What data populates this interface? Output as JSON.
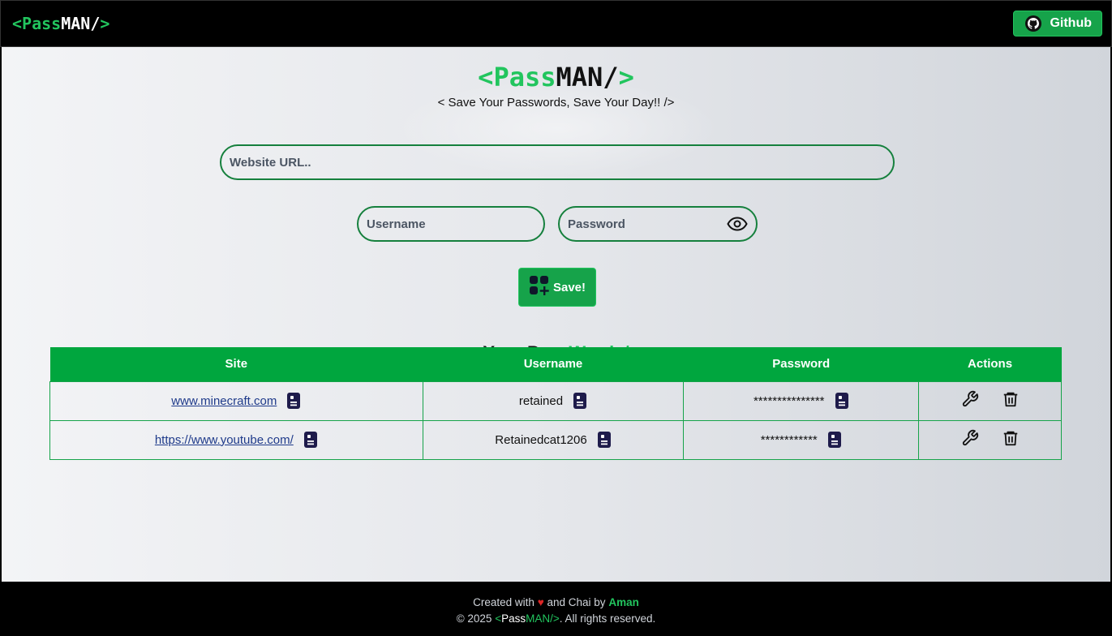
{
  "navbar": {
    "logo": {
      "open": "<",
      "pass": "Pass",
      "man": "MAN",
      "close": "/>"
    },
    "github_label": "Github"
  },
  "hero": {
    "title": {
      "open": "<",
      "pass": "Pass",
      "man": "MAN/",
      "close": ">"
    },
    "tagline": "< Save Your Passwords, Save Your Day!! />"
  },
  "form": {
    "url_placeholder": "Website URL..",
    "username_placeholder": "Username",
    "password_placeholder": "Password",
    "save_label": "Save!"
  },
  "section": {
    "title": {
      "open": "<",
      "your": "Your Pass",
      "words": "Words/",
      "close": ">"
    }
  },
  "table": {
    "headers": [
      "Site",
      "Username",
      "Password",
      "Actions"
    ],
    "rows": [
      {
        "site": "www.minecraft.com",
        "username": "retained",
        "password": "***************"
      },
      {
        "site": "https://www.youtube.com/",
        "username": "Retainedcat1206",
        "password": "************"
      }
    ]
  },
  "footer": {
    "created_prefix": "Created with",
    "heart": "♥",
    "created_suffix": "and Chai by",
    "author": "Aman",
    "copyright": "© 2025",
    "brand_open": "<",
    "brand_pass": "Pass",
    "brand_man": "MAN/>",
    "rights": ". All rights reserved."
  },
  "colors": {
    "accent": "#22c55e",
    "button": "#16a34a",
    "table_header": "#00a63e",
    "border": "#15803d"
  }
}
